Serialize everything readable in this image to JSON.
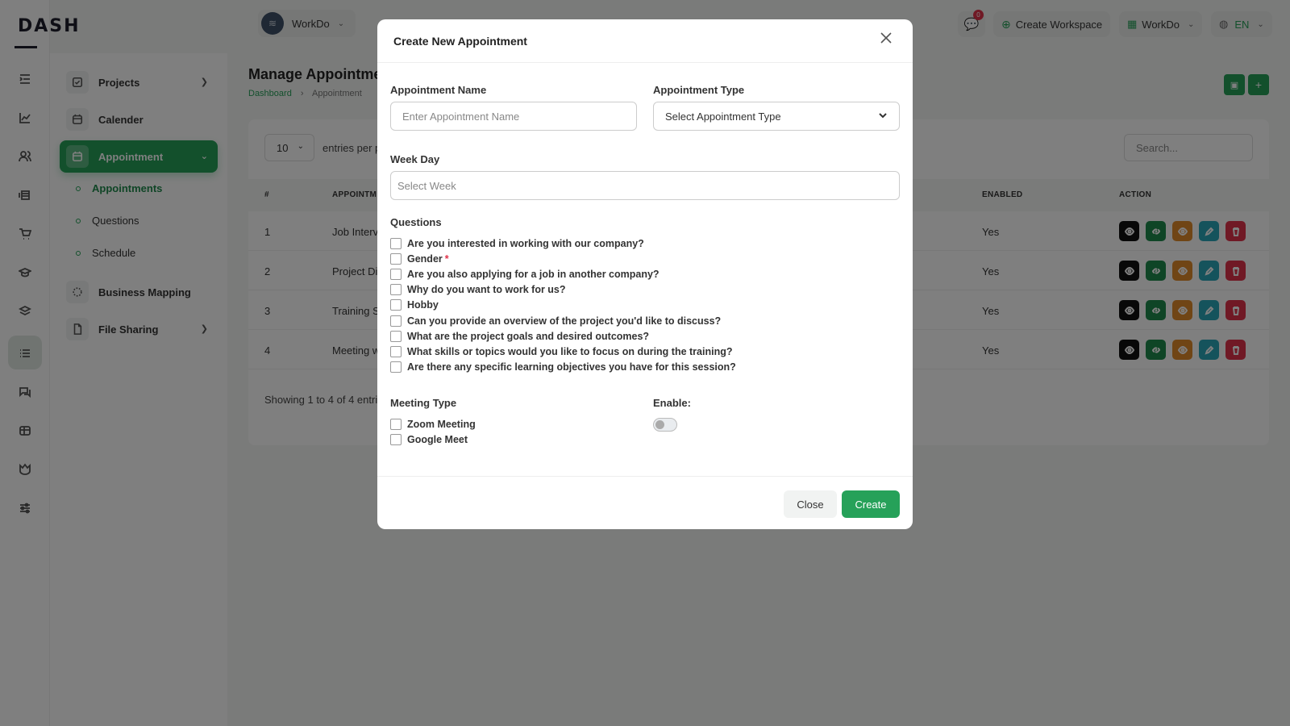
{
  "brand": {
    "logo": "DASH"
  },
  "header": {
    "workspace": "WorkDo",
    "notif_count": "0",
    "create_workspace": "Create Workspace",
    "company": "WorkDo",
    "lang": "EN"
  },
  "sidebar": {
    "items": [
      {
        "label": "Projects",
        "icon": "checkbox-icon"
      },
      {
        "label": "Calender",
        "icon": "calendar-icon"
      },
      {
        "label": "Appointment",
        "icon": "calendar-icon"
      },
      {
        "label": "Business Mapping",
        "icon": "circle-dashed-icon"
      },
      {
        "label": "File Sharing",
        "icon": "file-icon"
      }
    ],
    "subitems": [
      "Appointments",
      "Questions",
      "Schedule"
    ]
  },
  "page": {
    "title": "Manage Appointmen",
    "breadcrumb": [
      "Dashboard",
      "Appointment"
    ],
    "entries_value": "10",
    "entries_label": "entries per p",
    "search_placeholder": "Search...",
    "columns": [
      "#",
      "APPOINTM",
      "ENABLED",
      "ACTION"
    ],
    "rows": [
      {
        "num": "1",
        "name": "Job Interv",
        "enabled": "Yes"
      },
      {
        "num": "2",
        "name": "Project Di",
        "enabled": "Yes"
      },
      {
        "num": "3",
        "name": "Training S",
        "enabled": "Yes"
      },
      {
        "num": "4",
        "name": "Meeting w",
        "enabled": "Yes"
      }
    ],
    "showing": "Showing 1 to 4 of 4 entrie",
    "action_colors": [
      "#111111",
      "#1f8a4c",
      "#e08a2a",
      "#2aa7b8",
      "#e0324a"
    ]
  },
  "modal": {
    "title": "Create New Appointment",
    "name_label": "Appointment Name",
    "name_placeholder": "Enter Appointment Name",
    "type_label": "Appointment Type",
    "type_value": "Select Appointment Type",
    "week_label": "Week Day",
    "week_placeholder": "Select Week",
    "questions_label": "Questions",
    "questions": [
      "Are you interested in working with our company?",
      "Gender",
      "Are you also applying for a job in another company?",
      "Why do you want to work for us?",
      "Hobby",
      "Can you provide an overview of the project you'd like to discuss?",
      "What are the project goals and desired outcomes?",
      "What skills or topics would you like to focus on during the training?",
      "Are there any specific learning objectives you have for this session?"
    ],
    "required_mark": "*",
    "meeting_type_label": "Meeting Type",
    "meeting_types": [
      "Zoom Meeting",
      "Google Meet"
    ],
    "enable_label": "Enable:",
    "enabled": false,
    "close_label": "Close",
    "create_label": "Create"
  },
  "colors": {
    "accent": "#26a159",
    "danger": "#e0324a"
  }
}
